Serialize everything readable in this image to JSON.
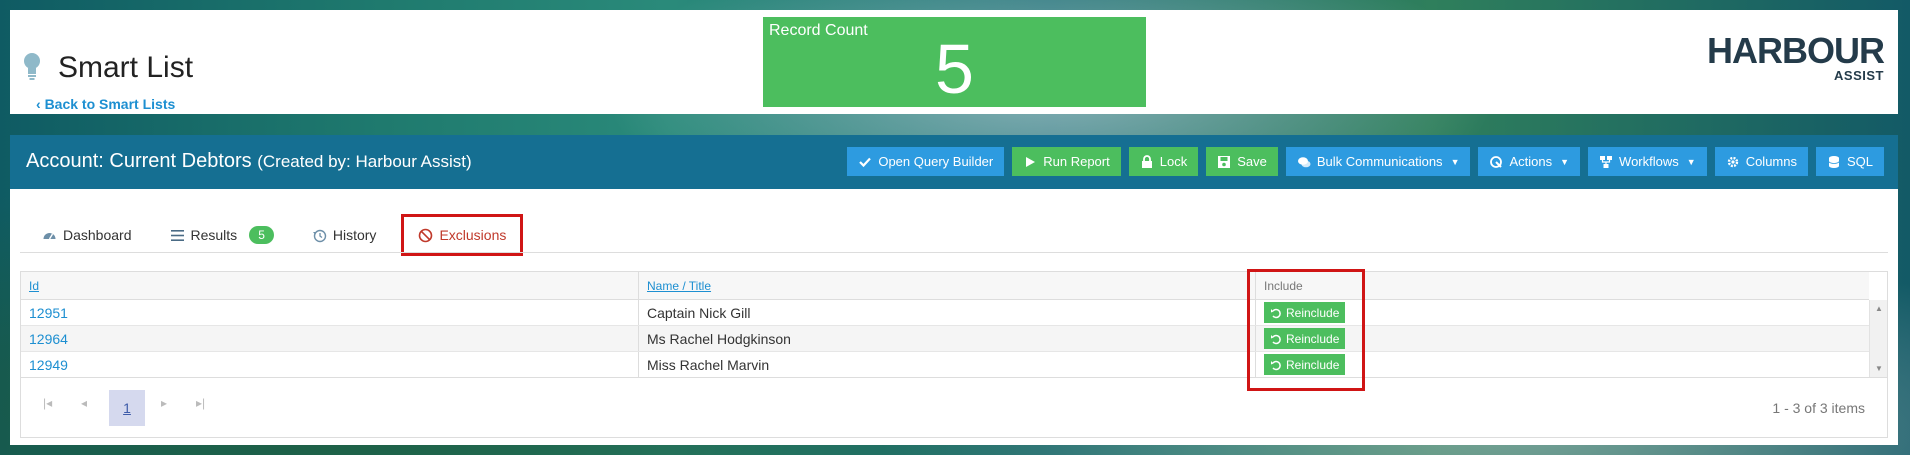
{
  "header": {
    "title": "Smart List",
    "back_link": "Back to Smart Lists",
    "record_count_label": "Record Count",
    "record_count_value": "5",
    "logo_main": "HARBOUR",
    "logo_sub": "ASSIST"
  },
  "panel": {
    "title": "Account: Current Debtors",
    "subtitle": "(Created by: Harbour Assist)",
    "toolbar": [
      {
        "label": "Open Query Builder",
        "icon": "check-icon",
        "color": "blue"
      },
      {
        "label": "Run Report",
        "icon": "play-icon",
        "color": "green"
      },
      {
        "label": "Lock",
        "icon": "lock-icon",
        "color": "green"
      },
      {
        "label": "Save",
        "icon": "save-icon",
        "color": "green"
      },
      {
        "label": "Bulk Communications",
        "icon": "chat-icon",
        "color": "blue",
        "dropdown": true
      },
      {
        "label": "Actions",
        "icon": "actions-icon",
        "color": "blue",
        "dropdown": true
      },
      {
        "label": "Workflows",
        "icon": "workflow-icon",
        "color": "blue",
        "dropdown": true
      },
      {
        "label": "Columns",
        "icon": "gear-icon",
        "color": "blue"
      },
      {
        "label": "SQL",
        "icon": "database-icon",
        "color": "blue"
      }
    ]
  },
  "tabs": {
    "dashboard": "Dashboard",
    "results": "Results",
    "results_count": "5",
    "history": "History",
    "exclusions": "Exclusions"
  },
  "grid": {
    "columns": {
      "id": "Id",
      "name": "Name / Title",
      "include": "Include"
    },
    "rows": [
      {
        "id": "12951",
        "name": "Captain Nick Gill",
        "action": "Reinclude"
      },
      {
        "id": "12964",
        "name": "Ms Rachel Hodgkinson",
        "action": "Reinclude"
      },
      {
        "id": "12949",
        "name": "Miss Rachel Marvin",
        "action": "Reinclude"
      }
    ]
  },
  "pager": {
    "current_page": "1",
    "info": "1 - 3 of 3 items"
  },
  "colors": {
    "accent_blue": "#156f92",
    "button_blue": "#2d9be0",
    "button_green": "#4cbe5e",
    "highlight_red": "#d01515"
  }
}
